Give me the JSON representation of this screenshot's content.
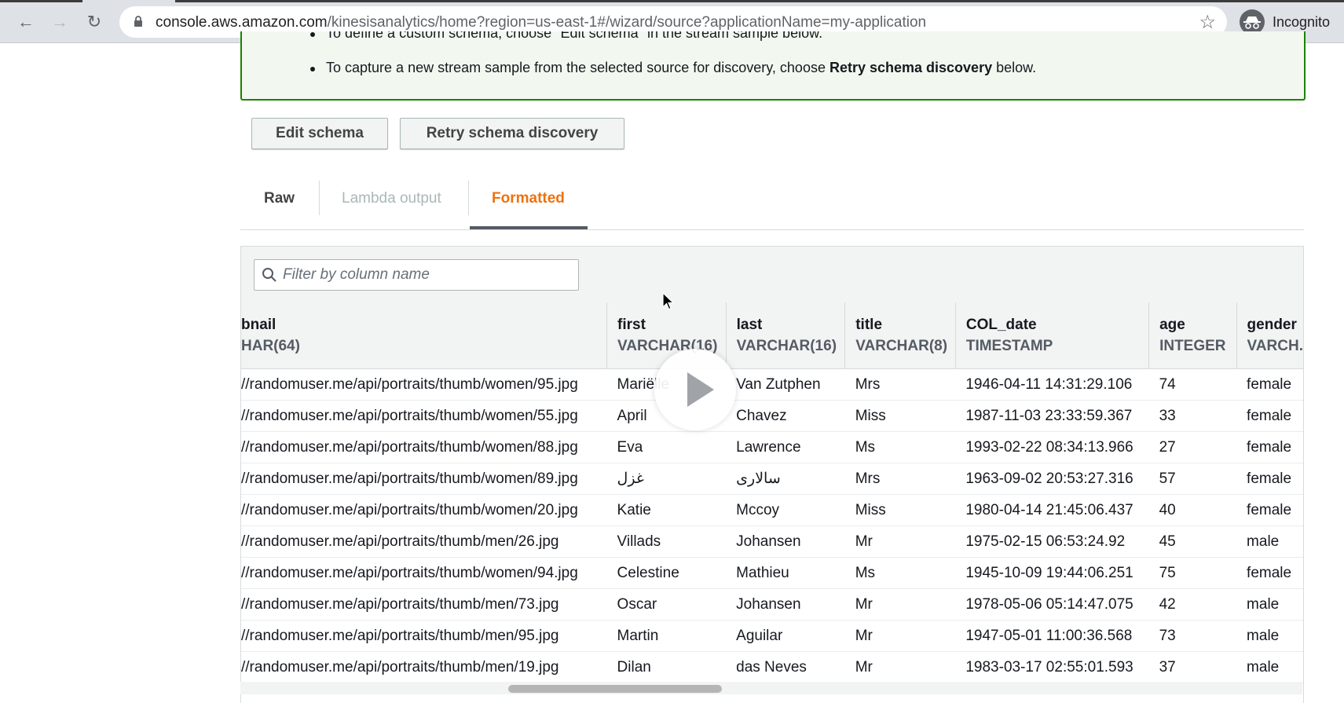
{
  "browser": {
    "url_host": "console.aws.amazon.com",
    "url_path": "/kinesisanalytics/home?region=us-east-1#/wizard/source?applicationName=my-application",
    "profile_label": "Incognito"
  },
  "notice": {
    "line_cut": "To define a custom schema, choose \"Edit schema\" in the stream sample below.",
    "line_full_prefix": "To capture a new stream sample from the selected source for discovery, choose ",
    "line_full_bold": "Retry schema discovery",
    "line_full_suffix": " below."
  },
  "actions": {
    "edit_schema": "Edit schema",
    "retry_discovery": "Retry schema discovery"
  },
  "tabs": {
    "raw": "Raw",
    "lambda": "Lambda output",
    "formatted": "Formatted"
  },
  "filter": {
    "placeholder": "Filter by column name"
  },
  "table": {
    "columns": [
      {
        "name": "bnail",
        "type": "HAR(64)"
      },
      {
        "name": "first",
        "type": "VARCHAR(16)"
      },
      {
        "name": "last",
        "type": "VARCHAR(16)"
      },
      {
        "name": "title",
        "type": "VARCHAR(8)"
      },
      {
        "name": "COL_date",
        "type": "TIMESTAMP"
      },
      {
        "name": "age",
        "type": "INTEGER"
      },
      {
        "name": "gender",
        "type": "VARCH."
      }
    ],
    "rows": [
      [
        "//randomuser.me/api/portraits/thumb/women/95.jpg",
        "Mariëlle",
        "Van Zutphen",
        "Mrs",
        "1946-04-11 14:31:29.106",
        "74",
        "female"
      ],
      [
        "//randomuser.me/api/portraits/thumb/women/55.jpg",
        "April",
        "Chavez",
        "Miss",
        "1987-11-03 23:33:59.367",
        "33",
        "female"
      ],
      [
        "//randomuser.me/api/portraits/thumb/women/88.jpg",
        "Eva",
        "Lawrence",
        "Ms",
        "1993-02-22 08:34:13.966",
        "27",
        "female"
      ],
      [
        "//randomuser.me/api/portraits/thumb/women/89.jpg",
        "غزل",
        "سالاری",
        "Mrs",
        "1963-09-02 20:53:27.316",
        "57",
        "female"
      ],
      [
        "//randomuser.me/api/portraits/thumb/women/20.jpg",
        "Katie",
        "Mccoy",
        "Miss",
        "1980-04-14 21:45:06.437",
        "40",
        "female"
      ],
      [
        "//randomuser.me/api/portraits/thumb/men/26.jpg",
        "Villads",
        "Johansen",
        "Mr",
        "1975-02-15 06:53:24.92",
        "45",
        "male"
      ],
      [
        "//randomuser.me/api/portraits/thumb/women/94.jpg",
        "Celestine",
        "Mathieu",
        "Ms",
        "1945-10-09 19:44:06.251",
        "75",
        "female"
      ],
      [
        "//randomuser.me/api/portraits/thumb/men/73.jpg",
        "Oscar",
        "Johansen",
        "Mr",
        "1978-05-06 05:14:47.075",
        "42",
        "male"
      ],
      [
        "//randomuser.me/api/portraits/thumb/men/95.jpg",
        "Martin",
        "Aguilar",
        "Mr",
        "1947-05-01 11:00:36.568",
        "73",
        "male"
      ],
      [
        "//randomuser.me/api/portraits/thumb/men/19.jpg",
        "Dilan",
        "das Neves",
        "Mr",
        "1983-03-17 02:55:01.593",
        "37",
        "male"
      ]
    ]
  },
  "colors": {
    "accent_orange": "#ec7211",
    "success_green": "#1d8102"
  }
}
